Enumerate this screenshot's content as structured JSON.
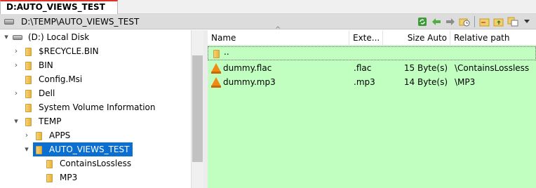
{
  "window": {
    "tab_title": "D:AUTO_VIEWS_TEST"
  },
  "pathbar": {
    "path": "D:\\TEMP\\AUTO_VIEWS_TEST",
    "toolbar_icons": [
      "refresh-icon",
      "back-arrow-icon",
      "forward-arrow-icon",
      "folder-history-icon",
      "new-folder-icon",
      "parent-folder-icon",
      "copy-icon",
      "dropdown-icon"
    ]
  },
  "tree": {
    "items": [
      {
        "label": "(D:) Local Disk",
        "expander": "▾",
        "icon": "drive-icon"
      },
      {
        "label": "$RECYCLE.BIN",
        "expander": "›",
        "icon": "folder-icon"
      },
      {
        "label": "BIN",
        "expander": "›",
        "icon": "folder-icon"
      },
      {
        "label": "Config.Msi",
        "expander": "",
        "icon": "folder-icon"
      },
      {
        "label": "Dell",
        "expander": "›",
        "icon": "folder-icon"
      },
      {
        "label": "System Volume Information",
        "expander": "",
        "icon": "folder-icon"
      },
      {
        "label": "TEMP",
        "expander": "▾",
        "icon": "folder-icon"
      },
      {
        "label": "APPS",
        "expander": "›",
        "icon": "folder-icon"
      },
      {
        "label": "AUTO_VIEWS_TEST",
        "expander": "▾",
        "icon": "folder-icon",
        "selected": true
      },
      {
        "label": "ContainsLossless",
        "expander": "",
        "icon": "folder-icon"
      },
      {
        "label": "MP3",
        "expander": "",
        "icon": "folder-icon"
      }
    ]
  },
  "list": {
    "columns": [
      "Name",
      "Exte...",
      "Size Auto",
      "Relative path"
    ],
    "parent_label": "..",
    "rows": [
      {
        "name": "dummy.flac",
        "ext": ".flac",
        "size": "15 Byte(s)",
        "path": "\\ContainsLossless"
      },
      {
        "name": "dummy.mp3",
        "ext": ".mp3",
        "size": "14 Byte(s)",
        "path": "\\MP3"
      }
    ],
    "background": "#c1ffc1"
  },
  "colors": {
    "tab_accent": "#d9342b",
    "selection": "#0b6fd2"
  }
}
